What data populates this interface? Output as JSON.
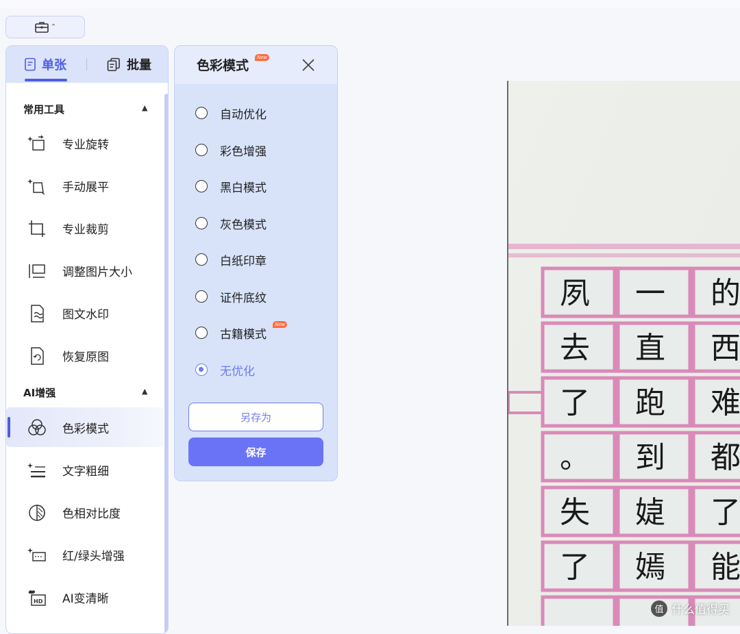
{
  "toolbox": {
    "icon": "toolbox-icon"
  },
  "tabs": {
    "single": "单张",
    "batch": "批量"
  },
  "sections": {
    "common": "常用工具",
    "ai": "AI增强"
  },
  "common_tools": [
    {
      "label": "专业旋转",
      "icon": "rotate-icon"
    },
    {
      "label": "手动展平",
      "icon": "flatten-icon"
    },
    {
      "label": "专业裁剪",
      "icon": "crop-icon"
    },
    {
      "label": "调整图片大小",
      "icon": "resize-icon"
    },
    {
      "label": "图文水印",
      "icon": "watermark-icon"
    },
    {
      "label": "恢复原图",
      "icon": "restore-icon"
    }
  ],
  "ai_tools": [
    {
      "label": "色彩模式",
      "icon": "color-mode-icon",
      "active": true
    },
    {
      "label": "文字粗细",
      "icon": "text-weight-icon"
    },
    {
      "label": "色相对比度",
      "icon": "contrast-icon"
    },
    {
      "label": "红/绿头增强",
      "icon": "red-green-icon"
    },
    {
      "label": "AI变清晰",
      "icon": "hd-icon"
    }
  ],
  "color_panel": {
    "title": "色彩模式",
    "new_badge": "New",
    "options": [
      {
        "label": "自动优化",
        "checked": false
      },
      {
        "label": "彩色增强",
        "checked": false
      },
      {
        "label": "黑白模式",
        "checked": false
      },
      {
        "label": "灰色模式",
        "checked": false
      },
      {
        "label": "白纸印章",
        "checked": false
      },
      {
        "label": "证件底纹",
        "checked": false
      },
      {
        "label": "古籍模式",
        "checked": false,
        "badge": "New"
      },
      {
        "label": "无优化",
        "checked": true
      }
    ],
    "save_as": "另存为",
    "save": "保存"
  },
  "document": {
    "characters": [
      "夙",
      "一",
      "的",
      "去",
      "直",
      "西",
      "了",
      "跑",
      "难",
      "。",
      "到",
      "都",
      "失",
      "媫",
      "了",
      "了",
      "嫣",
      "能"
    ]
  },
  "watermark": {
    "text": "什么值得买",
    "logo": "值"
  }
}
